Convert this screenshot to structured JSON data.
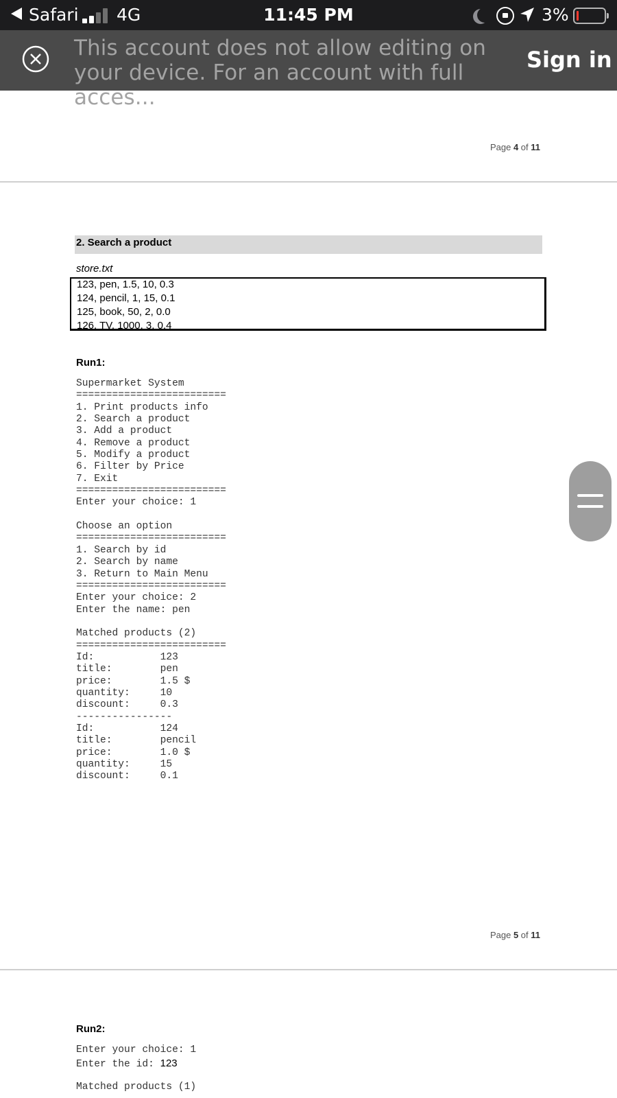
{
  "status_bar": {
    "app": "Safari",
    "network": "4G",
    "time": "11:45 PM",
    "battery": "3%",
    "icons": [
      "back-arrow-icon",
      "signal-icon",
      "moon-icon",
      "rotation-lock-icon",
      "location-icon",
      "battery-icon"
    ],
    "battery_color": "#ff3b30"
  },
  "banner": {
    "message": "This account does not allow editing on your device. For an account with full acces...",
    "more": "more",
    "sign_in": "Sign in",
    "background": "#4a4a4a"
  },
  "doc": {
    "page4": {
      "prefix": "Page ",
      "num": "4",
      "of": " of ",
      "total": "11"
    },
    "page5": {
      "prefix": "Page ",
      "num": "5",
      "of": " of ",
      "total": "11"
    },
    "section_title": "2. Search a product",
    "file_name": "store.txt",
    "store_lines": [
      "123, pen, 1.5, 10, 0.3",
      "124, pencil, 1, 15, 0.1",
      "125, book, 50, 2, 0.0",
      "126, TV, 1000, 3, 0.4"
    ],
    "run1_label": "Run1:",
    "run1_text": "Supermarket System\n=========================\n1. Print products info\n2. Search a product\n3. Add a product\n4. Remove a product\n5. Modify a product\n6. Filter by Price\n7. Exit\n=========================\nEnter your choice: 1\n\nChoose an option\n=========================\n1. Search by id\n2. Search by name\n3. Return to Main Menu\n=========================\nEnter your choice: 2\nEnter the name: pen\n\nMatched products (2)\n=========================\nId:           123\ntitle:        pen\nprice:        1.5 $\nquantity:     10\ndiscount:     0.3\n----------------\nId:           124\ntitle:        pencil\nprice:        1.0 $\nquantity:     15\ndiscount:     0.1",
    "run2_label": "Run2:",
    "run2_line1": "Enter your choice: 1",
    "run2_line2_prefix": "Enter the id: ",
    "run2_line2_value": "123",
    "run2_line3": "Matched products (1)"
  }
}
